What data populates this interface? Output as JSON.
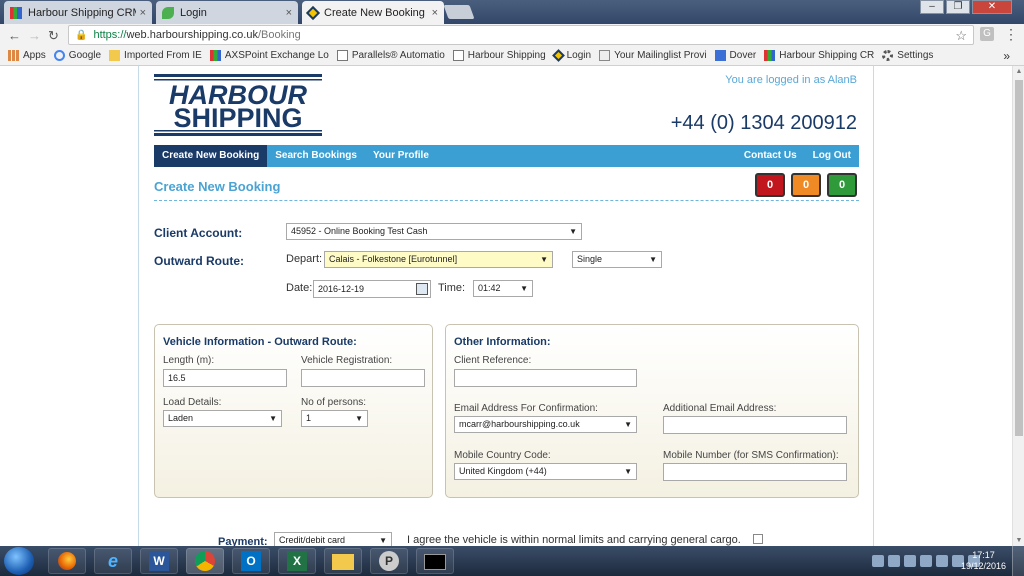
{
  "browser": {
    "tabs": [
      {
        "title": "Harbour Shipping CRM",
        "active": false
      },
      {
        "title": "Login",
        "active": false
      },
      {
        "title": "Create New Booking",
        "active": true
      }
    ],
    "close_glyph": "×",
    "url_scheme": "https://",
    "url_host": "web.harbourshipping.co.uk",
    "url_path": "/Booking",
    "bookmarks": [
      {
        "label": "Apps",
        "icon": "apps-grid-icon"
      },
      {
        "label": "Google",
        "icon": "google-icon"
      },
      {
        "label": "Imported From IE",
        "icon": "folder-icon"
      },
      {
        "label": "AXSPoint Exchange Lo",
        "icon": "chart-icon"
      },
      {
        "label": "Parallels® Automatio",
        "icon": "page-icon"
      },
      {
        "label": "Harbour Shipping",
        "icon": "page-icon"
      },
      {
        "label": "Login",
        "icon": "harbour-logo-icon"
      },
      {
        "label": "Your Mailinglist Provi",
        "icon": "mail-icon"
      },
      {
        "label": "Dover",
        "icon": "dover-icon"
      },
      {
        "label": "Harbour Shipping CR",
        "icon": "chart-icon"
      },
      {
        "label": "Settings",
        "icon": "gear-icon"
      }
    ],
    "more_bookmarks": "»"
  },
  "header": {
    "logo_line1": "HARBOUR",
    "logo_line2": "SHIPPING",
    "logged_in": "You are logged in as AlanB",
    "phone": "+44 (0) 1304 200912"
  },
  "nav": {
    "left": [
      "Create New Booking",
      "Search Bookings",
      "Your Profile"
    ],
    "right": [
      "Contact Us",
      "Log Out"
    ]
  },
  "page": {
    "title": "Create New Booking",
    "counters": [
      {
        "value": "0",
        "color": "#c1161d"
      },
      {
        "value": "0",
        "color": "#f08a24"
      },
      {
        "value": "0",
        "color": "#2e9a3a"
      }
    ]
  },
  "form": {
    "client_account_label": "Client Account:",
    "client_account_value": "45952 - Online Booking Test Cash",
    "outward_route_label": "Outward Route:",
    "depart_label": "Depart:",
    "depart_value": "Calais - Folkestone [Eurotunnel]",
    "trip_type_value": "Single",
    "date_label": "Date:",
    "date_value": "2016-12-19",
    "time_label": "Time:",
    "time_value": "01:42"
  },
  "vehicle": {
    "title": "Vehicle Information - Outward Route:",
    "length_label": "Length (m):",
    "length_value": "16.5",
    "registration_label": "Vehicle Registration:",
    "registration_value": "",
    "load_label": "Load Details:",
    "load_value": "Laden",
    "persons_label": "No of persons:",
    "persons_value": "1"
  },
  "other": {
    "title": "Other Information:",
    "client_ref_label": "Client Reference:",
    "client_ref_value": "",
    "email_confirm_label": "Email Address For Confirmation:",
    "email_confirm_value": "mcarr@harbourshipping.co.uk",
    "additional_email_label": "Additional Email Address:",
    "additional_email_value": "",
    "mobile_country_label": "Mobile Country Code:",
    "mobile_country_value": "United Kingdom (+44)",
    "mobile_number_label": "Mobile Number (for SMS Confirmation):",
    "mobile_number_value": ""
  },
  "payment": {
    "label": "Payment:",
    "value": "Credit/debit card",
    "agree_text": "I agree the vehicle is within normal limits and carrying general cargo."
  },
  "taskbar": {
    "time": "17:17",
    "date": "19/12/2016",
    "apps": [
      "firefox-icon",
      "ie-icon",
      "word-icon",
      "chrome-icon",
      "outlook-icon",
      "excel-icon",
      "explorer-icon",
      "parallels-icon",
      "cmd-icon"
    ]
  },
  "colors": {
    "brand_navy": "#1a3a67",
    "brand_blue": "#3c9fd3",
    "accent_text": "#4aa3d3"
  }
}
